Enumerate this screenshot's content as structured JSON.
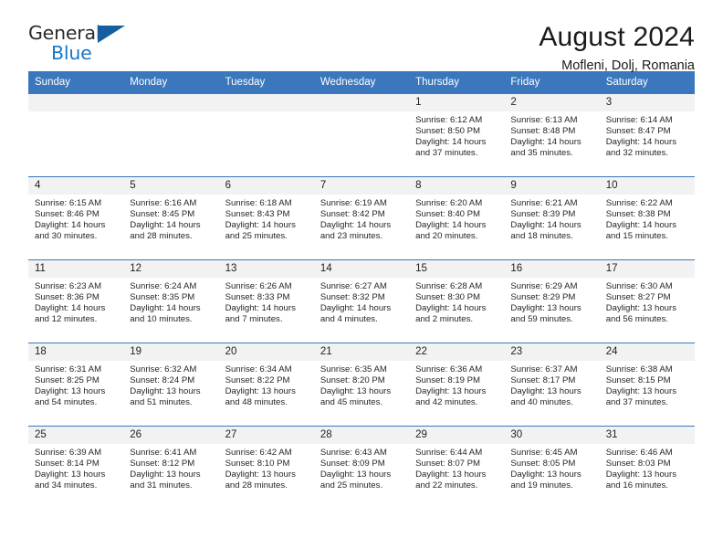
{
  "brand": {
    "name_part1": "General",
    "name_part2": "Blue",
    "triangle_icon": "triangle-icon",
    "accent_color": "#1878c8",
    "triangle_color": "#165e9e"
  },
  "header": {
    "title": "August 2024",
    "subtitle": "Mofleni, Dolj, Romania"
  },
  "calendar": {
    "header_bg": "#3a77bc",
    "daynum_bg": "#f2f2f2",
    "weekday_headers": [
      "Sunday",
      "Monday",
      "Tuesday",
      "Wednesday",
      "Thursday",
      "Friday",
      "Saturday"
    ],
    "weeks": [
      [
        {
          "day": "",
          "sunrise": "",
          "sunset": "",
          "daylight_line1": "",
          "daylight_line2": ""
        },
        {
          "day": "",
          "sunrise": "",
          "sunset": "",
          "daylight_line1": "",
          "daylight_line2": ""
        },
        {
          "day": "",
          "sunrise": "",
          "sunset": "",
          "daylight_line1": "",
          "daylight_line2": ""
        },
        {
          "day": "",
          "sunrise": "",
          "sunset": "",
          "daylight_line1": "",
          "daylight_line2": ""
        },
        {
          "day": "1",
          "sunrise": "Sunrise: 6:12 AM",
          "sunset": "Sunset: 8:50 PM",
          "daylight_line1": "Daylight: 14 hours",
          "daylight_line2": "and 37 minutes."
        },
        {
          "day": "2",
          "sunrise": "Sunrise: 6:13 AM",
          "sunset": "Sunset: 8:48 PM",
          "daylight_line1": "Daylight: 14 hours",
          "daylight_line2": "and 35 minutes."
        },
        {
          "day": "3",
          "sunrise": "Sunrise: 6:14 AM",
          "sunset": "Sunset: 8:47 PM",
          "daylight_line1": "Daylight: 14 hours",
          "daylight_line2": "and 32 minutes."
        }
      ],
      [
        {
          "day": "4",
          "sunrise": "Sunrise: 6:15 AM",
          "sunset": "Sunset: 8:46 PM",
          "daylight_line1": "Daylight: 14 hours",
          "daylight_line2": "and 30 minutes."
        },
        {
          "day": "5",
          "sunrise": "Sunrise: 6:16 AM",
          "sunset": "Sunset: 8:45 PM",
          "daylight_line1": "Daylight: 14 hours",
          "daylight_line2": "and 28 minutes."
        },
        {
          "day": "6",
          "sunrise": "Sunrise: 6:18 AM",
          "sunset": "Sunset: 8:43 PM",
          "daylight_line1": "Daylight: 14 hours",
          "daylight_line2": "and 25 minutes."
        },
        {
          "day": "7",
          "sunrise": "Sunrise: 6:19 AM",
          "sunset": "Sunset: 8:42 PM",
          "daylight_line1": "Daylight: 14 hours",
          "daylight_line2": "and 23 minutes."
        },
        {
          "day": "8",
          "sunrise": "Sunrise: 6:20 AM",
          "sunset": "Sunset: 8:40 PM",
          "daylight_line1": "Daylight: 14 hours",
          "daylight_line2": "and 20 minutes."
        },
        {
          "day": "9",
          "sunrise": "Sunrise: 6:21 AM",
          "sunset": "Sunset: 8:39 PM",
          "daylight_line1": "Daylight: 14 hours",
          "daylight_line2": "and 18 minutes."
        },
        {
          "day": "10",
          "sunrise": "Sunrise: 6:22 AM",
          "sunset": "Sunset: 8:38 PM",
          "daylight_line1": "Daylight: 14 hours",
          "daylight_line2": "and 15 minutes."
        }
      ],
      [
        {
          "day": "11",
          "sunrise": "Sunrise: 6:23 AM",
          "sunset": "Sunset: 8:36 PM",
          "daylight_line1": "Daylight: 14 hours",
          "daylight_line2": "and 12 minutes."
        },
        {
          "day": "12",
          "sunrise": "Sunrise: 6:24 AM",
          "sunset": "Sunset: 8:35 PM",
          "daylight_line1": "Daylight: 14 hours",
          "daylight_line2": "and 10 minutes."
        },
        {
          "day": "13",
          "sunrise": "Sunrise: 6:26 AM",
          "sunset": "Sunset: 8:33 PM",
          "daylight_line1": "Daylight: 14 hours",
          "daylight_line2": "and 7 minutes."
        },
        {
          "day": "14",
          "sunrise": "Sunrise: 6:27 AM",
          "sunset": "Sunset: 8:32 PM",
          "daylight_line1": "Daylight: 14 hours",
          "daylight_line2": "and 4 minutes."
        },
        {
          "day": "15",
          "sunrise": "Sunrise: 6:28 AM",
          "sunset": "Sunset: 8:30 PM",
          "daylight_line1": "Daylight: 14 hours",
          "daylight_line2": "and 2 minutes."
        },
        {
          "day": "16",
          "sunrise": "Sunrise: 6:29 AM",
          "sunset": "Sunset: 8:29 PM",
          "daylight_line1": "Daylight: 13 hours",
          "daylight_line2": "and 59 minutes."
        },
        {
          "day": "17",
          "sunrise": "Sunrise: 6:30 AM",
          "sunset": "Sunset: 8:27 PM",
          "daylight_line1": "Daylight: 13 hours",
          "daylight_line2": "and 56 minutes."
        }
      ],
      [
        {
          "day": "18",
          "sunrise": "Sunrise: 6:31 AM",
          "sunset": "Sunset: 8:25 PM",
          "daylight_line1": "Daylight: 13 hours",
          "daylight_line2": "and 54 minutes."
        },
        {
          "day": "19",
          "sunrise": "Sunrise: 6:32 AM",
          "sunset": "Sunset: 8:24 PM",
          "daylight_line1": "Daylight: 13 hours",
          "daylight_line2": "and 51 minutes."
        },
        {
          "day": "20",
          "sunrise": "Sunrise: 6:34 AM",
          "sunset": "Sunset: 8:22 PM",
          "daylight_line1": "Daylight: 13 hours",
          "daylight_line2": "and 48 minutes."
        },
        {
          "day": "21",
          "sunrise": "Sunrise: 6:35 AM",
          "sunset": "Sunset: 8:20 PM",
          "daylight_line1": "Daylight: 13 hours",
          "daylight_line2": "and 45 minutes."
        },
        {
          "day": "22",
          "sunrise": "Sunrise: 6:36 AM",
          "sunset": "Sunset: 8:19 PM",
          "daylight_line1": "Daylight: 13 hours",
          "daylight_line2": "and 42 minutes."
        },
        {
          "day": "23",
          "sunrise": "Sunrise: 6:37 AM",
          "sunset": "Sunset: 8:17 PM",
          "daylight_line1": "Daylight: 13 hours",
          "daylight_line2": "and 40 minutes."
        },
        {
          "day": "24",
          "sunrise": "Sunrise: 6:38 AM",
          "sunset": "Sunset: 8:15 PM",
          "daylight_line1": "Daylight: 13 hours",
          "daylight_line2": "and 37 minutes."
        }
      ],
      [
        {
          "day": "25",
          "sunrise": "Sunrise: 6:39 AM",
          "sunset": "Sunset: 8:14 PM",
          "daylight_line1": "Daylight: 13 hours",
          "daylight_line2": "and 34 minutes."
        },
        {
          "day": "26",
          "sunrise": "Sunrise: 6:41 AM",
          "sunset": "Sunset: 8:12 PM",
          "daylight_line1": "Daylight: 13 hours",
          "daylight_line2": "and 31 minutes."
        },
        {
          "day": "27",
          "sunrise": "Sunrise: 6:42 AM",
          "sunset": "Sunset: 8:10 PM",
          "daylight_line1": "Daylight: 13 hours",
          "daylight_line2": "and 28 minutes."
        },
        {
          "day": "28",
          "sunrise": "Sunrise: 6:43 AM",
          "sunset": "Sunset: 8:09 PM",
          "daylight_line1": "Daylight: 13 hours",
          "daylight_line2": "and 25 minutes."
        },
        {
          "day": "29",
          "sunrise": "Sunrise: 6:44 AM",
          "sunset": "Sunset: 8:07 PM",
          "daylight_line1": "Daylight: 13 hours",
          "daylight_line2": "and 22 minutes."
        },
        {
          "day": "30",
          "sunrise": "Sunrise: 6:45 AM",
          "sunset": "Sunset: 8:05 PM",
          "daylight_line1": "Daylight: 13 hours",
          "daylight_line2": "and 19 minutes."
        },
        {
          "day": "31",
          "sunrise": "Sunrise: 6:46 AM",
          "sunset": "Sunset: 8:03 PM",
          "daylight_line1": "Daylight: 13 hours",
          "daylight_line2": "and 16 minutes."
        }
      ]
    ]
  }
}
